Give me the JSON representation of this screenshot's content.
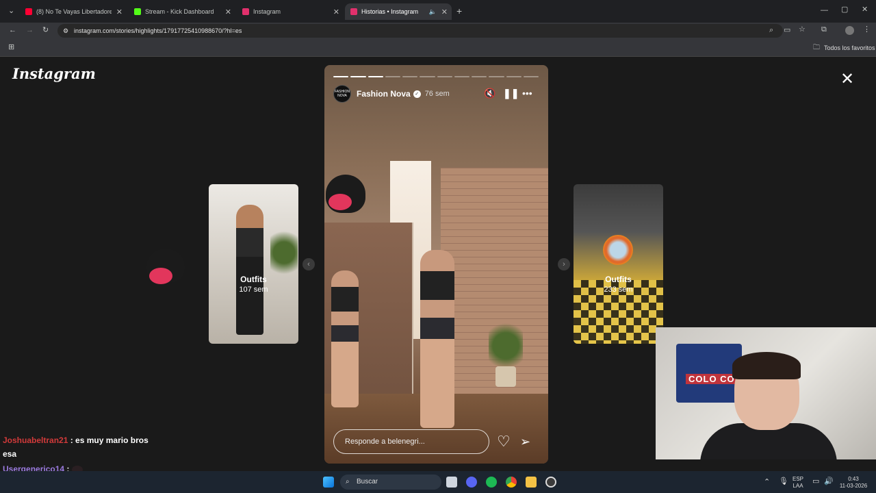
{
  "browser": {
    "tabs": [
      {
        "label": "(8) No Te Vayas Libertadores Ft.",
        "color": "#ff0033"
      },
      {
        "label": "Stream - Kick Dashboard",
        "color": "#53fc18"
      },
      {
        "label": "Instagram",
        "color": "#e1306c"
      },
      {
        "label": "Historias • Instagram",
        "color": "#e1306c"
      }
    ],
    "url": "instagram.com/stories/highlights/17917725410988670/?hl=es",
    "bookmarks_label": "Todos los favoritos"
  },
  "instagram": {
    "logo": "Instagram",
    "story": {
      "username": "Fashion Nova",
      "avatar_text": "FASHION NOVA",
      "time": "76 sem",
      "segments_total": 12,
      "segments_done": 3,
      "reply_placeholder": "Responde a belenegri..."
    },
    "prev_card": {
      "label": "Outfits",
      "time": "107 sem"
    },
    "next_card": {
      "label": "Outfits",
      "time": "233 sem"
    }
  },
  "webcam": {
    "poster_text": "COLO CO"
  },
  "chat": [
    {
      "user": "Joshuabeltran21",
      "sep": " : ",
      "msg": "es muy mario bros",
      "cont": "esa",
      "user_color": "#d23a3a"
    },
    {
      "user": "Usergenerico14",
      "sep": " : ",
      "msg": "",
      "cont": "",
      "user_color": "#9b7be0"
    }
  ],
  "taskbar": {
    "search": "Buscar",
    "lang_top": "ESP",
    "lang_bottom": "LAA",
    "time": "0:43",
    "date": "11-03-2026"
  }
}
